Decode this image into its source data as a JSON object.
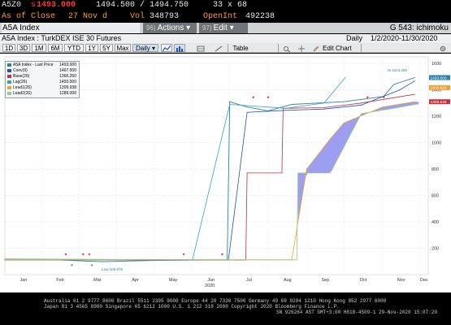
{
  "quote": {
    "ticker": "A5Z0",
    "price_prefix": "s",
    "price": "1493.000",
    "bid_ask": "1494.500 / 1494.750",
    "size": "33 x 68",
    "close_label": "As of Close",
    "close_date": "27 Nov d",
    "vol_label": "Vol",
    "vol_value": "348793",
    "oi_label": "OpenInt",
    "oi_value": "492238"
  },
  "titlebar": {
    "security": "A5A Index",
    "actions_num": "96)",
    "actions_label": "Actions ▾",
    "edit_num": "97)",
    "edit_label": "Edit ▾",
    "page_id": "G 543: ichimoku"
  },
  "chart_header": {
    "name": "A5A Index : TurkDEX ISE 30 Futures",
    "period": "Daily",
    "range": "1/2/2020-11/30/2020"
  },
  "toolbar": {
    "periods": [
      "1D",
      "3D",
      "1M",
      "6M",
      "YTD",
      "1Y",
      "5Y",
      "Max"
    ],
    "frequency": "Daily ▾",
    "table_label": "Table",
    "edit_chart_label": "Edit Chart"
  },
  "legend": [
    {
      "label": "A5A Index - Last Price",
      "value": "1493.000",
      "color": "#2b7fa8"
    },
    {
      "label": "Conv(9)",
      "value": "1467.000",
      "color": "#1f4fbf"
    },
    {
      "label": "Base(26)",
      "value": "1366.250",
      "color": "#c0303a"
    },
    {
      "label": "Lag(26)",
      "value": "1493.000",
      "color": "#3aa0c0"
    },
    {
      "label": "Lead1(26)",
      "value": "1309.938",
      "color": "#f0a030"
    },
    {
      "label": "Lead2(26)",
      "value": "1289.000",
      "color": "#90d080"
    }
  ],
  "annotations": {
    "hi": "Hi 1513.250",
    "low": "Low 106.975"
  },
  "right_labels": [
    "1493.000",
    "1416.625",
    "1309.938"
  ],
  "chart_data": {
    "type": "line",
    "x_range": [
      "2020-01-02",
      "2020-11-30"
    ],
    "xlabel": "2020",
    "x_tick_labels": [
      "Jan",
      "Feb",
      "Mar",
      "Apr",
      "May",
      "Jun",
      "Jul",
      "Aug",
      "Sep",
      "Oct",
      "Nov",
      "Dec"
    ],
    "y_tick_labels": [
      "1600",
      "1400",
      "1200",
      "1000",
      "800",
      "600",
      "400",
      "200"
    ],
    "ylim": [
      0,
      1650
    ],
    "grid": true,
    "legend_position": "top-left",
    "series": [
      {
        "name": "A5A Index - Last Price",
        "color": "#2b7fa8",
        "x": [
          "2020-01-02",
          "2020-02-15",
          "2020-03-20",
          "2020-05-01",
          "2020-06-29",
          "2020-07-01",
          "2020-07-15",
          "2020-08-01",
          "2020-08-20",
          "2020-09-10",
          "2020-10-01",
          "2020-11-02",
          "2020-11-10",
          "2020-11-27"
        ],
        "values": [
          118,
          110,
          98,
          108,
          112,
          1310,
          1270,
          1240,
          1290,
          1300,
          1310,
          1350,
          1440,
          1493
        ]
      },
      {
        "name": "Conv(9)",
        "color": "#1f4fbf",
        "x": [
          "2020-01-02",
          "2020-06-30",
          "2020-07-15",
          "2020-08-15",
          "2020-09-15",
          "2020-10-15",
          "2020-11-15",
          "2020-11-27"
        ],
        "values": [
          115,
          112,
          1230,
          1245,
          1255,
          1285,
          1400,
          1467
        ]
      },
      {
        "name": "Base(26)",
        "color": "#c0303a",
        "x": [
          "2020-01-02",
          "2020-07-14",
          "2020-07-15",
          "2020-08-12",
          "2020-08-13",
          "2020-09-15",
          "2020-10-15",
          "2020-11-27"
        ],
        "values": [
          110,
          110,
          770,
          770,
          1260,
          1265,
          1300,
          1366.25
        ]
      },
      {
        "name": "Lag(26)",
        "color": "#3aa0c0",
        "x": [
          "2020-01-02",
          "2020-06-01",
          "2020-07-01",
          "2020-08-15",
          "2020-09-15",
          "2020-10-02"
        ],
        "values": [
          118,
          112,
          1290,
          1260,
          1300,
          1493
        ]
      },
      {
        "name": "Lead1(26)",
        "color": "#f0a030",
        "x": [
          "2020-01-02",
          "2020-08-20",
          "2020-09-01",
          "2020-09-20",
          "2020-10-01",
          "2020-11-01",
          "2020-11-27"
        ],
        "values": [
          115,
          112,
          800,
          1030,
          1150,
          1270,
          1309.938
        ]
      },
      {
        "name": "Lead2(26)",
        "color": "#90d080",
        "x": [
          "2020-01-02",
          "2020-08-24",
          "2020-08-25",
          "2020-09-20",
          "2020-10-15",
          "2020-11-10",
          "2020-11-27"
        ],
        "values": [
          112,
          112,
          770,
          770,
          1220,
          1260,
          1289
        ]
      }
    ]
  },
  "footer": {
    "line1": "Australia 61 2 9777 8600 Brazil 5511 2395 9000 Europe 44 20 7330 7500 Germany 49 69 9204 1210 Hong Kong 852 2977 6000",
    "line2": "Japan 81 3 4565 8900        Singapore 65 6212 1000       U.S. 1 212 318 2000          Copyright 2020 Bloomberg Finance L.P.",
    "line3": "SN 926264 AST  GMT+3:00 H818-4509-1 29-Nov-2020 15:07:20"
  }
}
